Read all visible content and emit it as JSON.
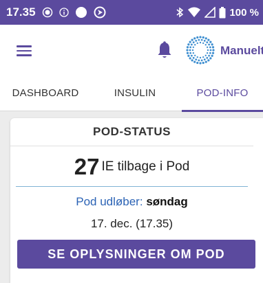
{
  "status_bar": {
    "time": "17.35",
    "battery": "100 %",
    "background_color": "#5b4a9e"
  },
  "app_bar": {
    "menu_icon": "hamburger-menu-icon",
    "notification_icon": "bell-icon",
    "mode_icon": "dotted-circle-icon",
    "mode_label": "Manuelt"
  },
  "tabs": [
    {
      "label": "DASHBOARD",
      "active": false
    },
    {
      "label": "INSULIN",
      "active": false
    },
    {
      "label": "POD-INFO",
      "active": true
    }
  ],
  "pod_status": {
    "title": "POD-STATUS",
    "reservoir_value": "27",
    "reservoir_text": "IE tilbage i Pod",
    "expires_label": "Pod udløber:",
    "expires_day": "søndag",
    "expires_date": "17. dec. (17.35)",
    "details_button": "SE OPLYSNINGER OM POD"
  },
  "colors": {
    "accent": "#5b4a9e",
    "link": "#2b63b5"
  }
}
